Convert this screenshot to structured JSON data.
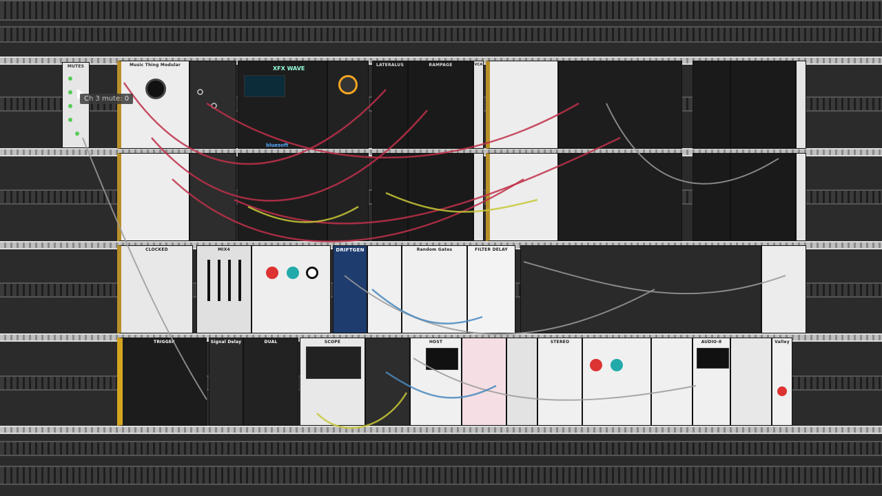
{
  "rack": {
    "modules": {
      "mutes": "MUTES",
      "music_thing": "Music Thing Modular",
      "wavecore": "XFX WAVE",
      "lateralus": "LATERALUS",
      "rampage": "RAMPAGE",
      "vca": "VCA",
      "clocked": "CLOCKED",
      "mix4": "MIX4",
      "driftgen": "DRIFTGEN",
      "random_gates": "Random Gates",
      "filter_delay": "FILTER DELAY",
      "trigger": "TRIGGER",
      "sign_delay": "Signal Delay",
      "dual": "DUAL",
      "scope": "SCOPE",
      "host": "HOST",
      "audio": "AUDIO-8",
      "stereo": "STEREO",
      "valley": "Valley",
      "bluesoft": "bluesoft"
    },
    "tooltip": "Ch 3 mute: 0"
  },
  "colors": {
    "rack_bg": "#2b2b2b",
    "cable_red": "#c0304a",
    "cable_yellow": "#c8c838",
    "cable_gray": "#9a9a9a",
    "cable_blue": "#4a8ac0"
  }
}
